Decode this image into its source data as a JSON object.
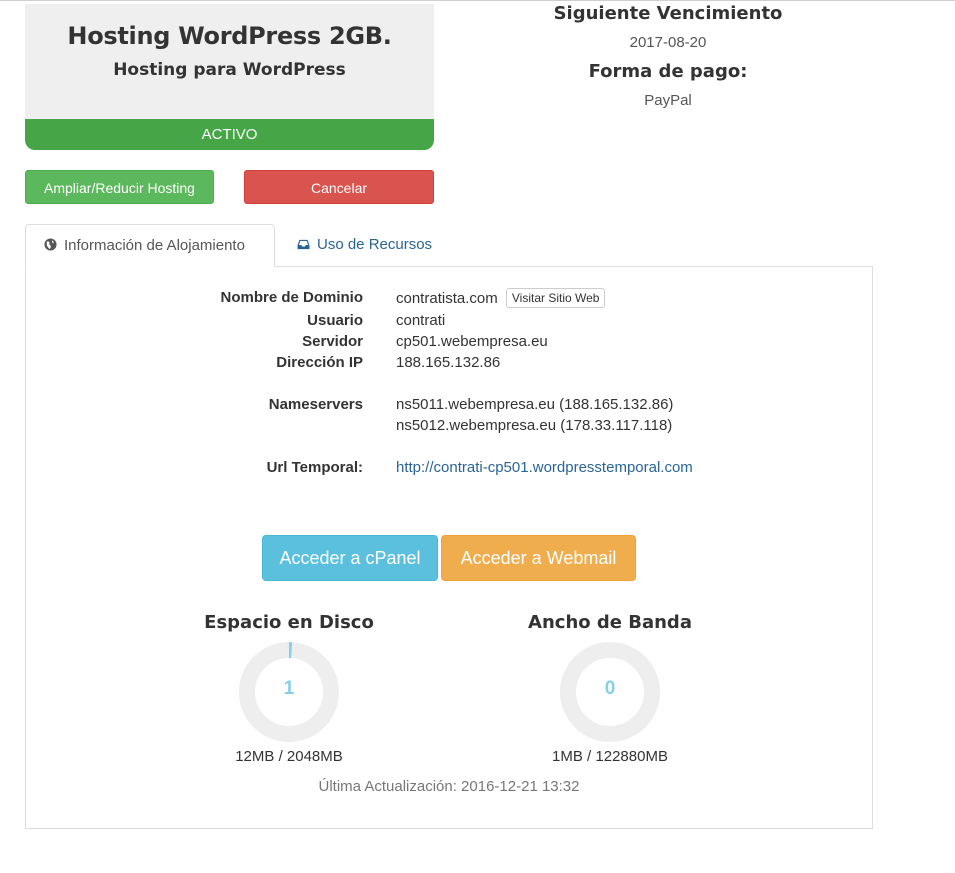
{
  "product": {
    "name": "Hosting WordPress 2GB.",
    "group": "Hosting para WordPress",
    "status": "ACTIVO"
  },
  "billing": {
    "next_due_label": "Siguiente Vencimiento",
    "next_due_value": "2017-08-20",
    "payment_label": "Forma de pago:",
    "payment_value": "PayPal"
  },
  "actions": {
    "upgrade_label": "Ampliar/Reducir Hosting",
    "cancel_label": "Cancelar"
  },
  "tabs": [
    {
      "label": "Información de Alojamiento",
      "icon": "globe-icon"
    },
    {
      "label": "Uso de Recursos",
      "icon": "inbox-icon"
    }
  ],
  "hosting_info": {
    "domain_label": "Nombre de Dominio",
    "domain_value": "contratista.com",
    "visit_label": "Visitar Sitio Web",
    "user_label": "Usuario",
    "user_value": "contrati",
    "server_label": "Servidor",
    "server_value": "cp501.webempresa.eu",
    "ip_label": "Dirección IP",
    "ip_value": "188.165.132.86",
    "ns_label": "Nameservers",
    "ns1": "ns5011.webempresa.eu (188.165.132.86)",
    "ns2": "ns5012.webempresa.eu (178.33.117.118)",
    "temp_url_label": "Url Temporal:",
    "temp_url_value": "http://contrati-cp501.wordpresstemporal.com"
  },
  "access": {
    "cpanel_label": "Acceder a cPanel",
    "webmail_label": "Acceder a Webmail"
  },
  "usage": {
    "disk_title": "Espacio en Disco",
    "disk_percent": "1",
    "disk_text": "12MB / 2048MB",
    "bw_title": "Ancho de Banda",
    "bw_percent": "0",
    "bw_text": "1MB / 122880MB",
    "last_update": "Última Actualización: 2016-12-21 13:32"
  },
  "colors": {
    "status_active": "#46a546",
    "gauge_fill": "#87ceeb",
    "gauge_track": "#eeeeee"
  }
}
